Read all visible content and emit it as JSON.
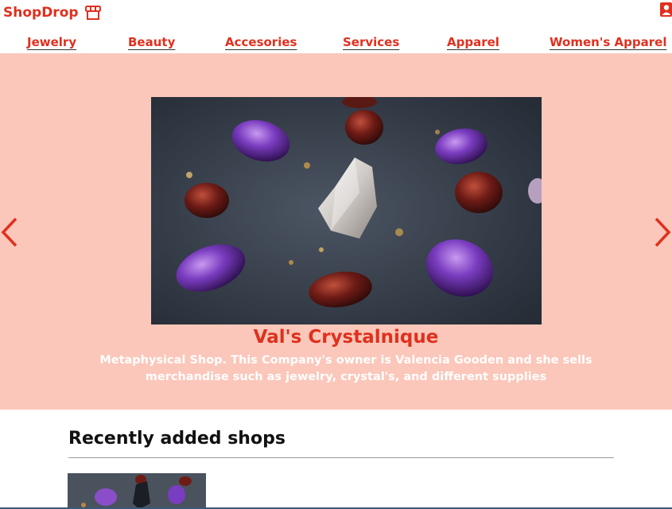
{
  "header": {
    "brand": "ShopDrop",
    "brand_icon": "storefront-icon",
    "account_icon": "user-account-icon",
    "accent_color": "#e0301e"
  },
  "nav": {
    "items": [
      "Jewelry",
      "Beauty",
      "Accesories",
      "Services",
      "Apparel",
      "Women's Apparel"
    ]
  },
  "carousel": {
    "background_color": "#fbc7ba",
    "prev_icon": "chevron-left-icon",
    "next_icon": "chevron-right-icon",
    "slide": {
      "title": "Val's Crystalnique",
      "description": "Metaphysical Shop. This Company's owner is Valencia Gooden and she sells merchandise such as jewelry, crystal's, and different supplies",
      "image": "crystals-photo"
    }
  },
  "recent": {
    "heading": "Recently added shops"
  }
}
